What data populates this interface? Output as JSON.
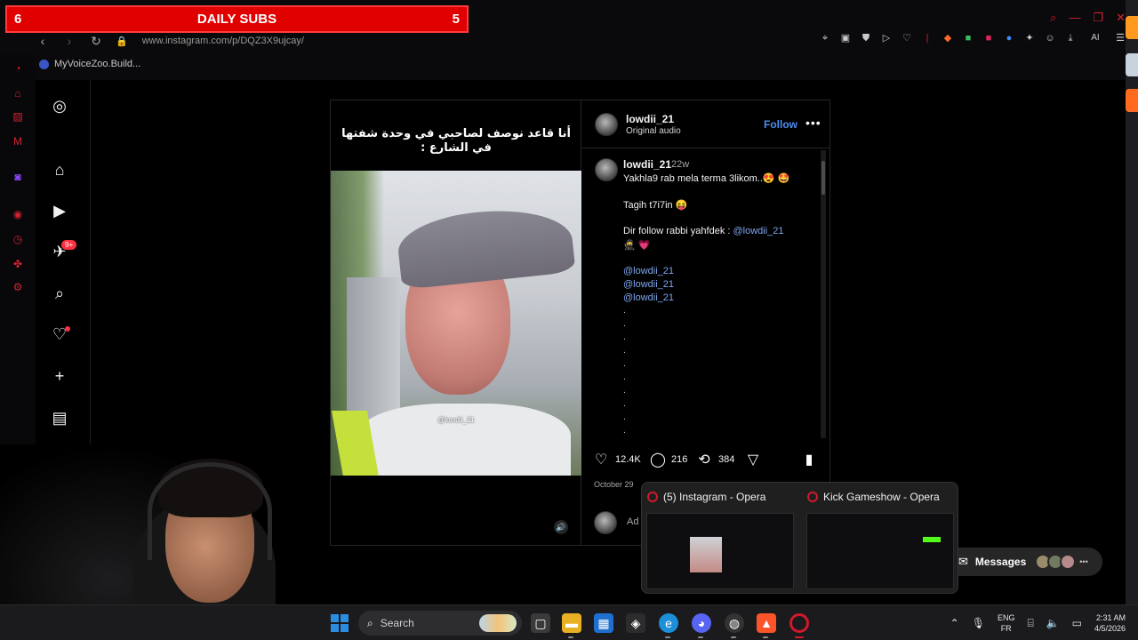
{
  "overlay": {
    "left_number": "6",
    "title": "DAILY SUBS",
    "right_number": "5"
  },
  "browser": {
    "url": "www.instagram.com/p/DQZ3X9ujcay/",
    "bookmark": "MyVoiceZoo.Build...",
    "ai_label": "AI"
  },
  "instagram": {
    "nav": {
      "notification_badge": "9+"
    },
    "post": {
      "caption_arabic_line1": "أنا قاعد نوصف لصاحبي في وحدة شفتها",
      "caption_arabic_line2": "في الشارع :",
      "video_watermark": "@lowdii_21",
      "header_username": "lowdii_21",
      "header_audio": "Original audio",
      "follow_label": "Follow",
      "more_label": "•••",
      "comment_username": "lowdii_21",
      "comment_time": "22w",
      "comment_line1": "Yakhla9 rab mela terma 3likom..😍 🤩",
      "comment_line2": "Tagih t7i7in 😝",
      "comment_line3_text": "Dir follow rabbi yahfdek : ",
      "comment_line3_link": "@lowdii_21",
      "comment_line4": "🥷 💗",
      "mentions": [
        "@lowdii_21",
        "@lowdii_21",
        "@lowdii_21"
      ],
      "likes": "12.4K",
      "comments": "216",
      "reposts": "384",
      "date": "October 29",
      "add_comment_placeholder": "Ad"
    },
    "messages_label": "Messages"
  },
  "taskbar_preview": [
    {
      "title": "(5) Instagram - Opera"
    },
    {
      "title": "Kick Gameshow - Opera"
    }
  ],
  "taskbar": {
    "search_label": "Search",
    "lang_line1": "ENG",
    "lang_line2": "FR",
    "time": "2:31 AM",
    "date": "4/5/2026"
  },
  "colors": {
    "banner_red": "#e00000",
    "opera_red": "#d1182c",
    "ig_link": "#4a8ef0",
    "ig_badge": "#ff3040"
  }
}
